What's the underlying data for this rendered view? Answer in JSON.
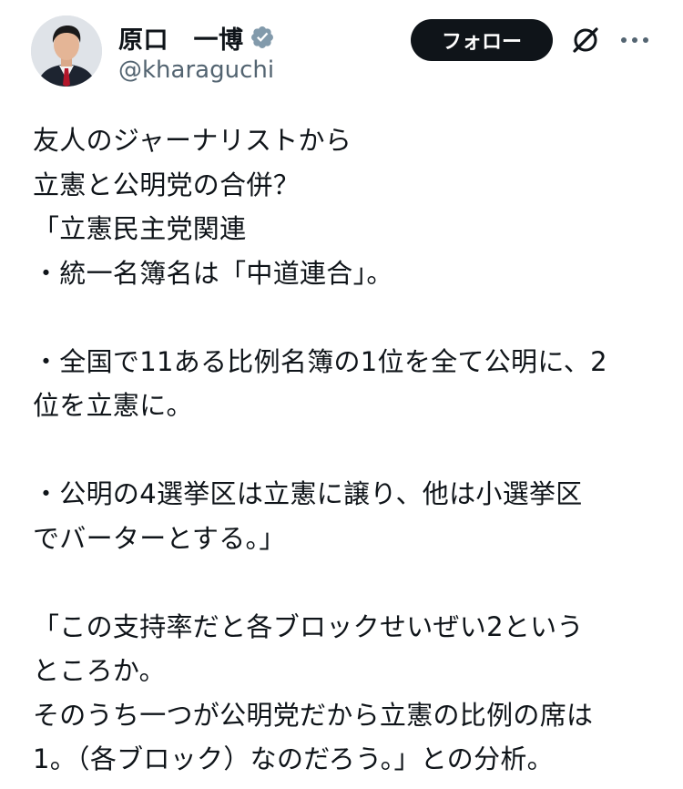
{
  "author": {
    "display_name": "原口　一博",
    "handle": "@kharaguchi",
    "verified": true,
    "verified_color": "#829aab"
  },
  "actions": {
    "follow_label": "フォロー",
    "grok_icon": "grok-slash-icon",
    "more_icon": "more-horizontal-icon"
  },
  "post": {
    "lines": [
      "友人のジャーナリストから",
      "立憲と公明党の合併？",
      "「立憲民主党関連",
      "・統一名簿名は「中道連合」。",
      "",
      "・全国で11ある比例名簿の1位を全て公明に、2",
      "位を立憲に。",
      "",
      "・公明の4選挙区は立憲に譲り、他は小選挙区",
      "でバーターとする。」",
      "",
      "「この支持率だと各ブロックせいぜい2という",
      "ところか。",
      "そのうち一つが公明党だから立憲の比例の席は",
      "1。（各ブロック）なのだろう。」との分析。"
    ]
  },
  "colors": {
    "text": "#0f1419",
    "secondary": "#536471",
    "button_bg": "#0f1419",
    "button_text": "#ffffff"
  }
}
